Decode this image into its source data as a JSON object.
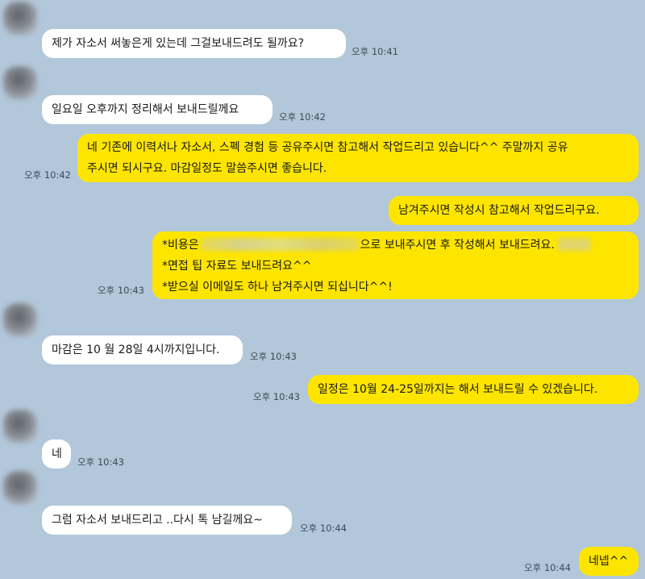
{
  "messages": [
    {
      "dir": "in",
      "text": "제가 자소서 써놓은게 있는데 그걸보내드려도 될까요?",
      "time": "오후 10:41"
    },
    {
      "dir": "in",
      "text": "일요일 오후까지 정리해서 보내드릴께요",
      "time": "오후 10:42"
    },
    {
      "dir": "out",
      "line1": "네 기존에 이력서나 자소서, 스펙 경험 등 공유주시면 참고해서 작업드리고 있습니다^^ 주말까지 공유",
      "line2": "주시면 되시구요. 마감일정도 말씀주시면 좋습니다.",
      "time": "오후 10:42"
    },
    {
      "dir": "out",
      "text": "남겨주시면 작성시 참고해서 작업드리구요.",
      "time": ""
    },
    {
      "dir": "out",
      "line1a": "*비용은",
      "line1b": "으로 보내주시면 후 작성해서 보내드려요.",
      "line2": "*면접 팁 자료도 보내드려요^^",
      "line3": "*받으실 이메일도 하나 남겨주시면 되십니다^^!",
      "time": "오후 10:43"
    },
    {
      "dir": "in",
      "text": "마감은 10 월 28일 4시까지입니다.",
      "time": "오후 10:43"
    },
    {
      "dir": "out",
      "text": "일정은 10월 24-25일까지는 해서 보내드릴 수 있겠습니다.",
      "time": "오후 10:43"
    },
    {
      "dir": "in",
      "text": "네",
      "time": "오후 10:43"
    },
    {
      "dir": "in",
      "text": "그럼 자소서 보내드리고 ..다시 톡 남길께요~",
      "time": "오후 10:44"
    },
    {
      "dir": "out",
      "text": "네넵^^",
      "time": "오후 10:44"
    }
  ]
}
